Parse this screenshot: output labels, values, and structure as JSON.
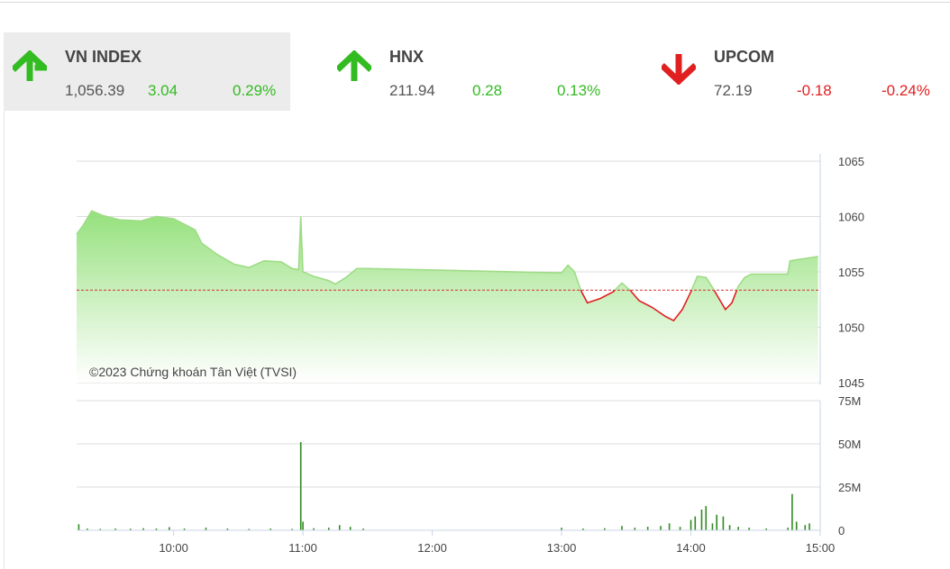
{
  "tabs": [
    {
      "name": "VN INDEX",
      "value": "1,056.39",
      "change": "3.04",
      "percent": "0.29%",
      "direction": "up"
    },
    {
      "name": "HNX",
      "value": "211.94",
      "change": "0.28",
      "percent": "0.13%",
      "direction": "up"
    },
    {
      "name": "UPCOM",
      "value": "72.19",
      "change": "-0.18",
      "percent": "-0.24%",
      "direction": "down"
    }
  ],
  "colors": {
    "up": "#33bb22",
    "down": "#e02020",
    "area": "#a8e890",
    "volume": "#2e8b1e"
  },
  "chart_data": {
    "type": "area",
    "copyright": "©2023 Chứng khoán Tân Việt (TVSI)",
    "reference": 1053.35,
    "price_axis": {
      "ylim": [
        1045,
        1065
      ],
      "ticks": [
        "1065",
        "1060",
        "1055",
        "1050",
        "1045"
      ]
    },
    "volume_axis": {
      "ylim": [
        0,
        75
      ],
      "ticks": [
        "75M",
        "50M",
        "25M",
        "0"
      ]
    },
    "time_ticks": [
      "10:00",
      "11:00",
      "12:00",
      "13:00",
      "14:00",
      "15:00"
    ],
    "price_series": [
      [
        "09:15",
        1058.4
      ],
      [
        "09:18",
        1059.2
      ],
      [
        "09:22",
        1060.5
      ],
      [
        "09:27",
        1060.1
      ],
      [
        "09:35",
        1059.7
      ],
      [
        "09:45",
        1059.6
      ],
      [
        "09:52",
        1060.0
      ],
      [
        "10:00",
        1059.8
      ],
      [
        "10:05",
        1059.3
      ],
      [
        "10:10",
        1058.8
      ],
      [
        "10:13",
        1057.6
      ],
      [
        "10:20",
        1056.6
      ],
      [
        "10:28",
        1055.7
      ],
      [
        "10:35",
        1055.4
      ],
      [
        "10:42",
        1056.0
      ],
      [
        "10:50",
        1055.9
      ],
      [
        "10:55",
        1055.3
      ],
      [
        "10:58",
        1055.2
      ],
      [
        "10:59",
        1060.0
      ],
      [
        "11:00",
        1055.0
      ],
      [
        "11:05",
        1054.6
      ],
      [
        "11:12",
        1054.2
      ],
      [
        "11:15",
        1053.9
      ],
      [
        "11:20",
        1054.5
      ],
      [
        "11:25",
        1055.3
      ],
      [
        "11:30",
        1055.3
      ],
      [
        "13:00",
        1054.9
      ],
      [
        "13:03",
        1055.6
      ],
      [
        "13:06",
        1055.0
      ],
      [
        "13:09",
        1053.3
      ],
      [
        "13:12",
        1052.2
      ],
      [
        "13:18",
        1052.6
      ],
      [
        "13:24",
        1053.2
      ],
      [
        "13:28",
        1054.0
      ],
      [
        "13:32",
        1053.3
      ],
      [
        "13:36",
        1052.4
      ],
      [
        "13:42",
        1051.8
      ],
      [
        "13:48",
        1051.0
      ],
      [
        "13:52",
        1050.6
      ],
      [
        "13:56",
        1051.6
      ],
      [
        "14:00",
        1053.2
      ],
      [
        "14:03",
        1054.6
      ],
      [
        "14:07",
        1054.5
      ],
      [
        "14:10",
        1053.6
      ],
      [
        "14:13",
        1052.6
      ],
      [
        "14:16",
        1051.6
      ],
      [
        "14:19",
        1052.2
      ],
      [
        "14:22",
        1053.7
      ],
      [
        "14:25",
        1054.5
      ],
      [
        "14:28",
        1054.8
      ],
      [
        "14:45",
        1054.8
      ],
      [
        "14:46",
        1056.0
      ],
      [
        "14:59",
        1056.39
      ]
    ],
    "volume_series": [
      [
        "09:16",
        3.5
      ],
      [
        "09:20",
        1
      ],
      [
        "09:26",
        0.8
      ],
      [
        "09:33",
        1
      ],
      [
        "09:40",
        0.9
      ],
      [
        "09:46",
        1.2
      ],
      [
        "09:52",
        1
      ],
      [
        "09:58",
        1.8
      ],
      [
        "10:05",
        1
      ],
      [
        "10:15",
        1.5
      ],
      [
        "10:25",
        1
      ],
      [
        "10:35",
        0.8
      ],
      [
        "10:45",
        1
      ],
      [
        "10:55",
        0.8
      ],
      [
        "10:59",
        51
      ],
      [
        "11:00",
        5
      ],
      [
        "11:05",
        1.2
      ],
      [
        "11:12",
        1.5
      ],
      [
        "11:17",
        3
      ],
      [
        "11:22",
        2
      ],
      [
        "11:28",
        1
      ],
      [
        "13:00",
        1.5
      ],
      [
        "13:10",
        1
      ],
      [
        "13:20",
        1.2
      ],
      [
        "13:28",
        2.5
      ],
      [
        "13:34",
        1.5
      ],
      [
        "13:40",
        2
      ],
      [
        "13:46",
        2.5
      ],
      [
        "13:50",
        4
      ],
      [
        "13:55",
        2
      ],
      [
        "14:00",
        6
      ],
      [
        "14:02",
        8
      ],
      [
        "14:05",
        12
      ],
      [
        "14:07",
        14
      ],
      [
        "14:10",
        4
      ],
      [
        "14:12",
        9
      ],
      [
        "14:15",
        8
      ],
      [
        "14:18",
        3
      ],
      [
        "14:22",
        2
      ],
      [
        "14:27",
        1.5
      ],
      [
        "14:35",
        1
      ],
      [
        "14:45",
        1.5
      ],
      [
        "14:47",
        21
      ],
      [
        "14:49",
        5
      ],
      [
        "14:53",
        3
      ],
      [
        "14:55",
        4
      ]
    ]
  }
}
